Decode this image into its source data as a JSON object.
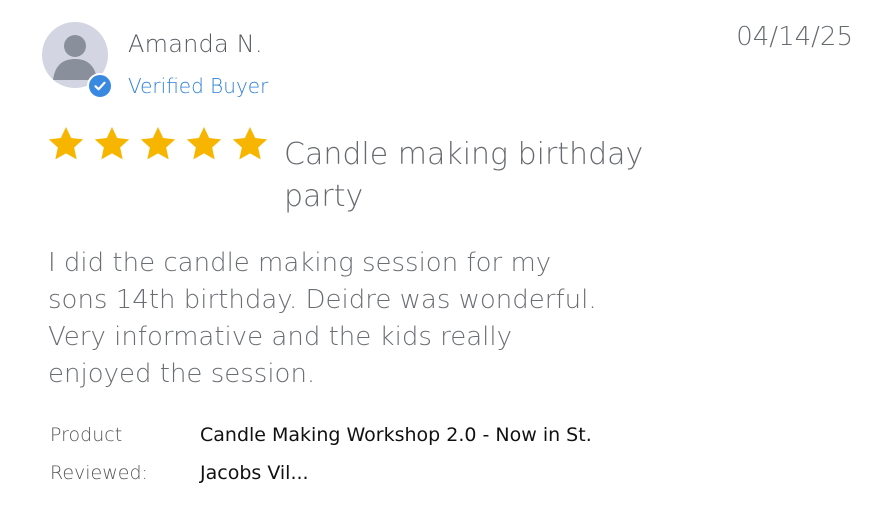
{
  "reviewer": {
    "name": "Amanda N.",
    "verified_label": "Verified Buyer",
    "avatar_icon": "user-silhouette-icon",
    "badge_icon": "checkmark-icon"
  },
  "date": "04/14/25",
  "rating": {
    "stars": 5,
    "max": 5,
    "icon": "star-icon",
    "color": "#f7b500"
  },
  "review": {
    "title": "Candle making birthday party",
    "body": "I did the candle making session for my sons 14th birthday. Deidre was wonderful. Very informative and the kids really enjoyed the session."
  },
  "meta": {
    "product_label": "Product",
    "product_value": "Candle Making Workshop 2.0 - Now in St.",
    "reviewed_label": "Reviewed:",
    "reviewed_value": "Jacobs Vil..."
  },
  "colors": {
    "verified": "#2f80d8",
    "badge": "#3a89e0",
    "avatar_bg": "#d3d6e2",
    "avatar_fg": "#8a8f9c"
  }
}
